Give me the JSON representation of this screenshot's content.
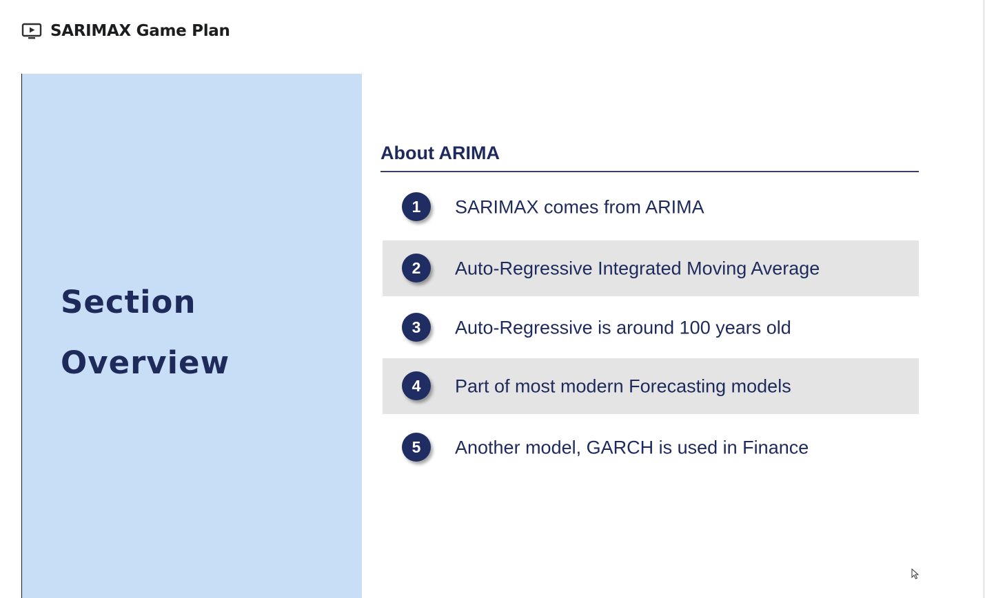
{
  "header": {
    "title": "SARIMAX Game Plan",
    "icon": "video-player-icon"
  },
  "slide": {
    "section_title_line1": "Section",
    "section_title_line2": "Overview",
    "about_title": "About ARIMA",
    "items": [
      {
        "number": "1",
        "text": "SARIMAX comes from ARIMA"
      },
      {
        "number": "2",
        "text": "Auto-Regressive Integrated Moving Average"
      },
      {
        "number": "3",
        "text": "Auto-Regressive is around 100 years old"
      },
      {
        "number": "4",
        "text": "Part of most modern Forecasting models"
      },
      {
        "number": "5",
        "text": "Another model, GARCH is used in Finance"
      }
    ]
  },
  "colors": {
    "left_panel": "#c8ddf6",
    "navy": "#1f2d63",
    "shaded_row": "#e4e4e4"
  }
}
